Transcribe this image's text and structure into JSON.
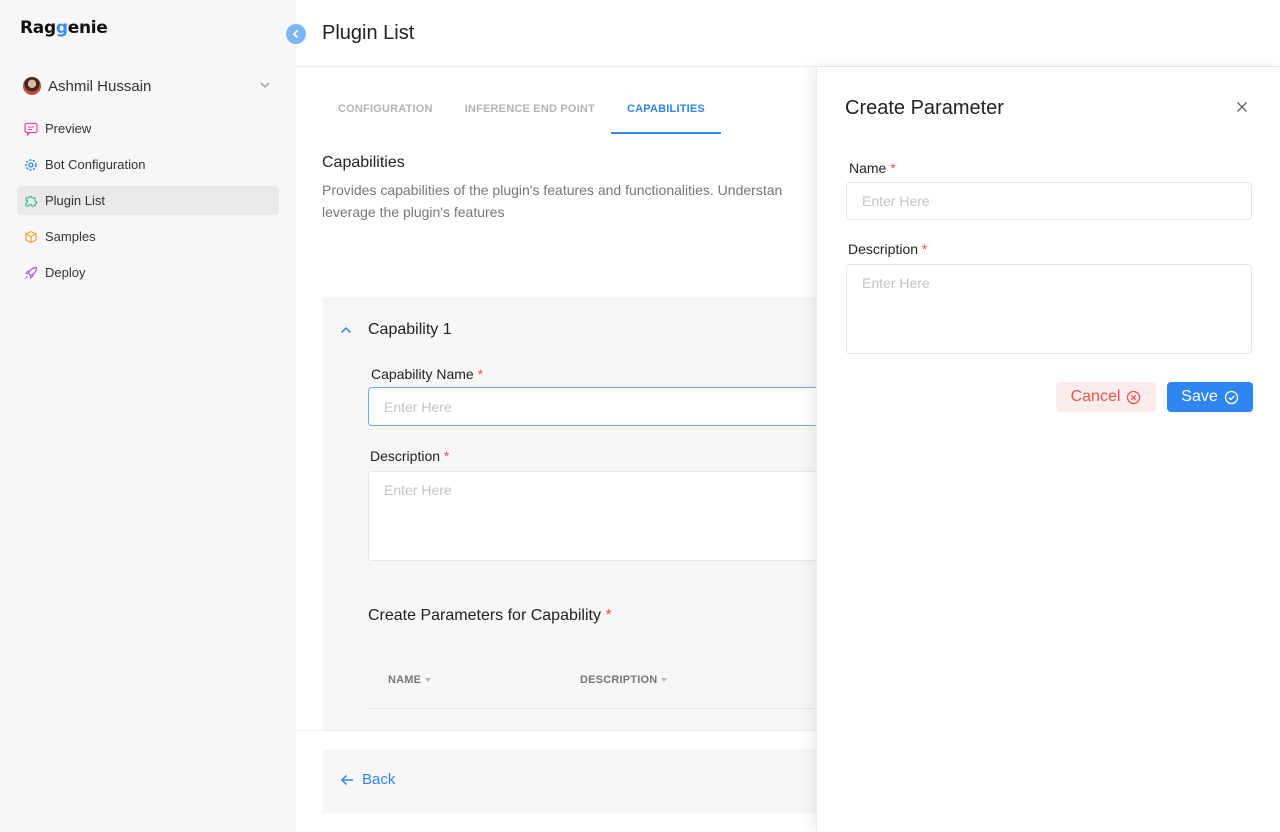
{
  "brand": {
    "logo_pre": "Rag",
    "logo_g": "g",
    "logo_post": "enie"
  },
  "user": {
    "name": "Ashmil Hussain"
  },
  "sidebar": {
    "items": [
      {
        "label": "Preview",
        "icon": "chat-icon"
      },
      {
        "label": "Bot Configuration",
        "icon": "gear-icon"
      },
      {
        "label": "Plugin List",
        "icon": "puzzle-icon",
        "active": true
      },
      {
        "label": "Samples",
        "icon": "box-icon"
      },
      {
        "label": "Deploy",
        "icon": "rocket-icon"
      }
    ]
  },
  "header": {
    "title": "Plugin List"
  },
  "tabs": [
    {
      "label": "CONFIGURATION"
    },
    {
      "label": "INFERENCE END POINT"
    },
    {
      "label": "CAPABILITIES",
      "active": true
    }
  ],
  "capabilities": {
    "title": "Capabilities",
    "desc_line1": "Provides capabilities of the plugin's features and functionalities. Understan",
    "desc_line2": "leverage the plugin's features"
  },
  "capability": {
    "title": "Capability 1",
    "name_label": "Capability Name",
    "name_placeholder": "Enter Here",
    "desc_label": "Description",
    "desc_placeholder": "Enter Here",
    "params_title": "Create Parameters for Capability",
    "columns": [
      "NAME",
      "DESCRIPTION"
    ]
  },
  "required_mark": "*",
  "footer": {
    "back_label": "Back"
  },
  "drawer": {
    "title": "Create Parameter",
    "name_label": "Name",
    "name_placeholder": "Enter Here",
    "desc_label": "Description",
    "desc_placeholder": "Enter Here",
    "cancel_label": "Cancel",
    "save_label": "Save"
  },
  "colors": {
    "accent": "#2f86f0",
    "danger": "#f0534b",
    "danger_bg": "#fdecec",
    "sidebar_bg": "#f7f7f7"
  }
}
